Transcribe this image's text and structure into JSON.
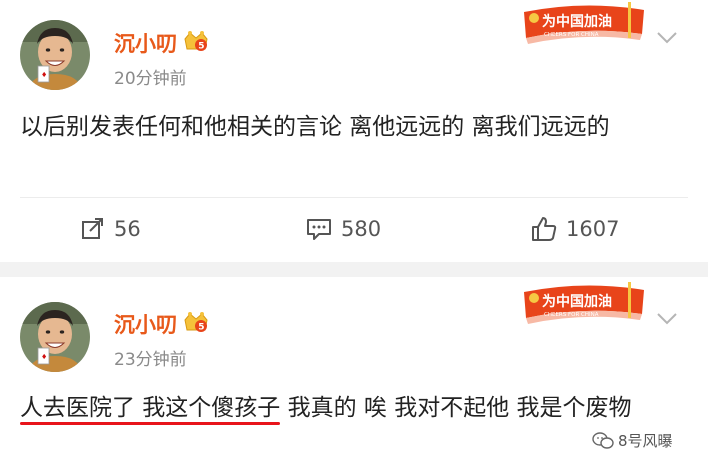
{
  "posts": [
    {
      "author": "沉小叨",
      "time": "20分钟前",
      "text": "以后别发表任何和他相关的言论 离他远远的 离我们远远的",
      "banner_text": "为中国加油",
      "banner_sub": "CHEERS FOR CHINA",
      "badge_level": "5",
      "stats": {
        "shares": "56",
        "comments": "580",
        "likes": "1607"
      }
    },
    {
      "author": "沉小叨",
      "time": "23分钟前",
      "text_underlined": "人去医院了 我这个傻孩子",
      "text_rest": " 我真的 唉 我对不起他 我是个废物",
      "banner_text": "为中国加油",
      "banner_sub": "CHEERS FOR CHINA",
      "badge_level": "5"
    }
  ],
  "watermark": "8号风曝",
  "colors": {
    "name": "#e8591a",
    "underline": "#e8141b",
    "banner": "#e8441a",
    "separator": "#f2f2f2"
  },
  "icons": {
    "share": "share-icon",
    "comment": "comment-icon",
    "like": "thumbs-up-icon",
    "badge": "crown-badge-icon",
    "chevron": "chevron-down-icon"
  }
}
